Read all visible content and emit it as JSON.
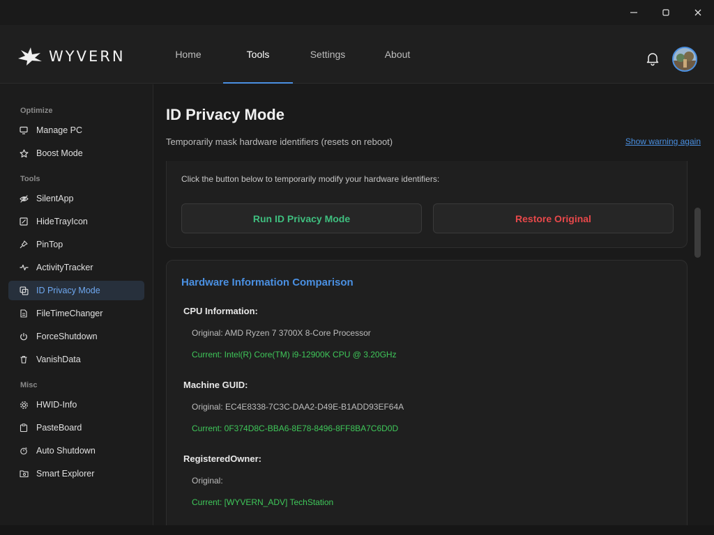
{
  "window": {
    "controls": [
      "minimize",
      "maximize",
      "close"
    ]
  },
  "header": {
    "logo_text": "WYVERN",
    "nav": [
      {
        "label": "Home",
        "active": false
      },
      {
        "label": "Tools",
        "active": true
      },
      {
        "label": "Settings",
        "active": false
      },
      {
        "label": "About",
        "active": false
      }
    ],
    "accent_color": "#4a90e2"
  },
  "sidebar": {
    "sections": [
      {
        "title": "Optimize",
        "items": [
          {
            "label": "Manage PC",
            "icon": "monitor-icon"
          },
          {
            "label": "Boost Mode",
            "icon": "star-icon"
          }
        ]
      },
      {
        "title": "Tools",
        "items": [
          {
            "label": "SilentApp",
            "icon": "eye-off-icon"
          },
          {
            "label": "HideTrayIcon",
            "icon": "tray-icon"
          },
          {
            "label": "PinTop",
            "icon": "pin-icon"
          },
          {
            "label": "ActivityTracker",
            "icon": "activity-icon"
          },
          {
            "label": "ID Privacy Mode",
            "icon": "copy-icon",
            "active": true
          },
          {
            "label": "FileTimeChanger",
            "icon": "file-icon"
          },
          {
            "label": "ForceShutdown",
            "icon": "power-icon"
          },
          {
            "label": "VanishData",
            "icon": "trash-icon"
          }
        ]
      },
      {
        "title": "Misc",
        "items": [
          {
            "label": "HWID-Info",
            "icon": "gear-icon"
          },
          {
            "label": "PasteBoard",
            "icon": "clipboard-icon"
          },
          {
            "label": "Auto Shutdown",
            "icon": "timer-icon"
          },
          {
            "label": "Smart Explorer",
            "icon": "folder-search-icon"
          }
        ]
      }
    ]
  },
  "main": {
    "title": "ID Privacy Mode",
    "subtitle": "Temporarily mask hardware identifiers (resets on reboot)",
    "warning_link": "Show warning again",
    "instruction": "Click the button below to temporarily modify your hardware identifiers:",
    "run_button": "Run ID Privacy Mode",
    "restore_button": "Restore Original",
    "comparison": {
      "title": "Hardware Information Comparison",
      "groups": [
        {
          "title": "CPU Information:",
          "original": "Original: AMD Ryzen 7 3700X 8-Core Processor",
          "current": "Current: Intel(R) Core(TM) i9-12900K CPU @ 3.20GHz"
        },
        {
          "title": "Machine GUID:",
          "original": "Original: EC4E8338-7C3C-DAA2-D49E-B1ADD93EF64A",
          "current": "Current: 0F374D8C-BBA6-8E78-8496-8FF8BA7C6D0D"
        },
        {
          "title": "RegisteredOwner:",
          "original": "Original:",
          "current": "Current: [WYVERN_ADV] TechStation"
        }
      ]
    },
    "colors": {
      "run": "#3fbf7f",
      "restore": "#e8484a",
      "current": "#3fc85a"
    }
  }
}
